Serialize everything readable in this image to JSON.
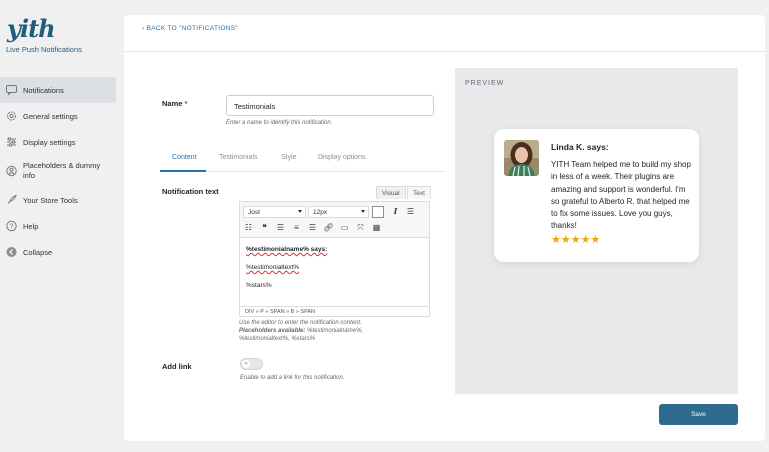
{
  "brand": {
    "logo": "yith",
    "plugin_name": "Live Push Notifications"
  },
  "sidebar": {
    "items": [
      {
        "label": "Notifications",
        "icon": "notification-icon",
        "active": true
      },
      {
        "label": "General settings",
        "icon": "gear-icon"
      },
      {
        "label": "Display settings",
        "icon": "sliders-icon"
      },
      {
        "label": "Placeholders & dummy info",
        "icon": "user-circle-icon"
      },
      {
        "label": "Your Store Tools",
        "icon": "rocket-icon"
      },
      {
        "label": "Help",
        "icon": "help-icon"
      },
      {
        "label": "Collapse",
        "icon": "collapse-icon"
      }
    ]
  },
  "header": {
    "back_link": "BACK TO \"NOTIFICATIONS\""
  },
  "form": {
    "name_label": "Name",
    "name_required_mark": "*",
    "name_value": "Testimonials",
    "name_help": "Enter a name to identify this notification.",
    "tabs": [
      "Content",
      "Testimonials",
      "Style",
      "Display options"
    ],
    "active_tab": "Content",
    "notification_text_label": "Notification text",
    "editor": {
      "tab_visual": "Visual",
      "tab_text": "Text",
      "font_family": "Jost",
      "font_size": "12px",
      "body": [
        "%testimonialname% says:",
        "%testimonialtext%",
        "%stars%"
      ],
      "status_path": "DIV » P » SPAN » B » SPAN"
    },
    "editor_help_line1": "Use the editor to enter the notification content.",
    "placeholders_label": "Placeholders available:",
    "placeholders_list_1": "%testimonialname%,",
    "placeholders_list_2": "%testimonialtext%, %stars%",
    "add_link_label": "Add link",
    "add_link_toggle_glyph": "✕",
    "add_link_help": "Enable to add a link for this notification."
  },
  "preview": {
    "title": "PREVIEW",
    "author": "Linda K. says:",
    "message": "YITH Team helped me to build my shop in less of a week. Their plugins are amazing and support is wonderful. I'm so grateful to Alberto R. that helped me to fix some issues. Love you guys, thanks!",
    "stars": "★★★★★",
    "rating": 5,
    "star_color": "#f0a30a"
  },
  "actions": {
    "save": "Save"
  },
  "colors": {
    "accent": "#2271b1",
    "save_button": "#2e6b8f",
    "brand": "#1f5e7a"
  }
}
